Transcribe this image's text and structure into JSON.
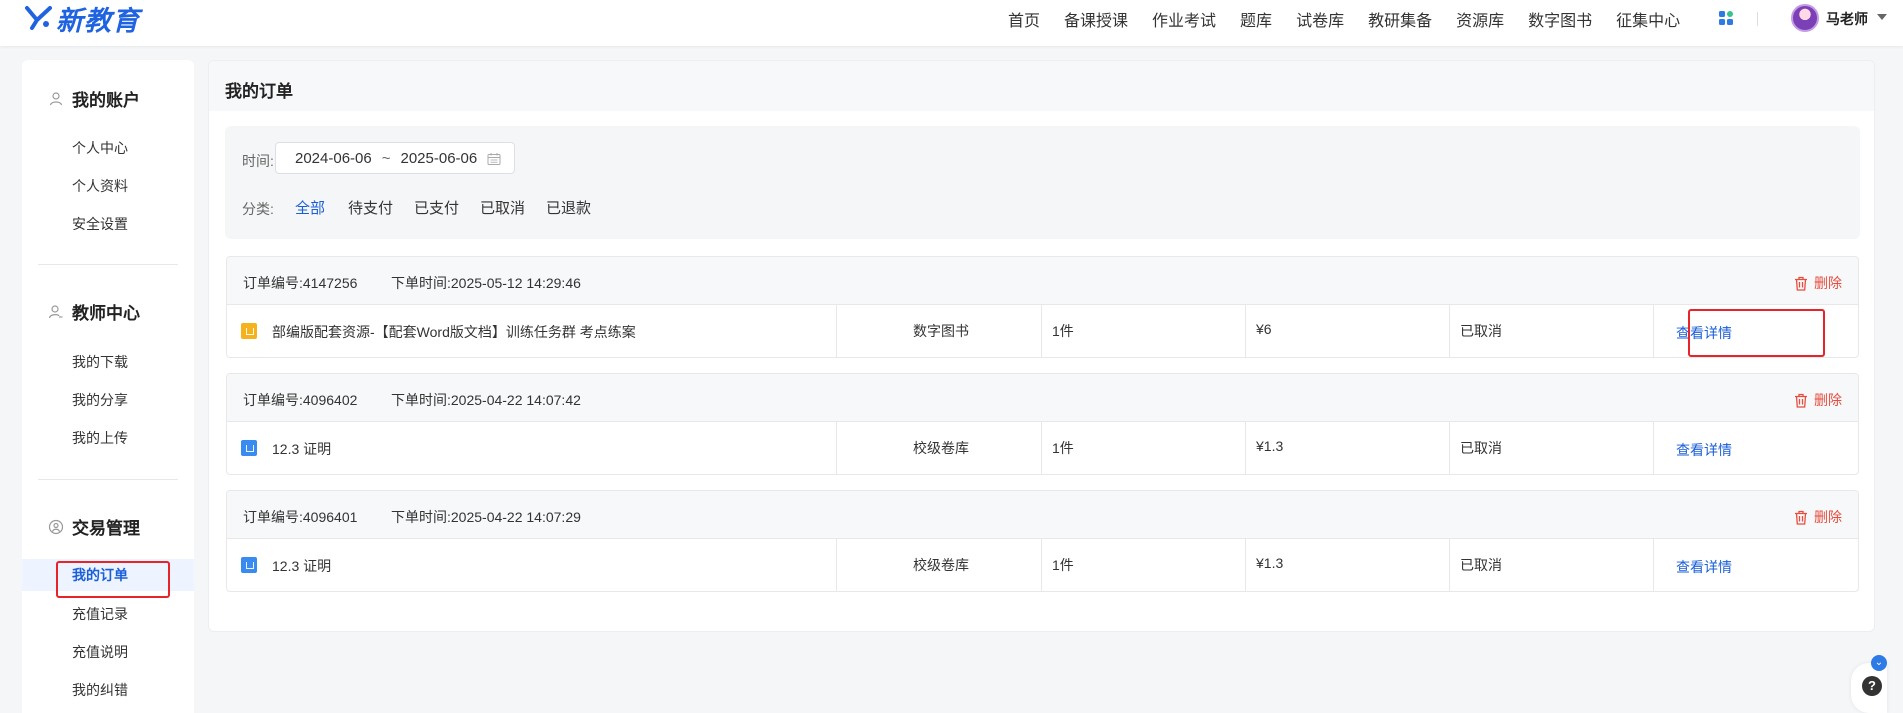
{
  "brand": {
    "name": "新教育",
    "color": "#1f63e0"
  },
  "nav": {
    "items": [
      "首页",
      "备课授课",
      "作业考试",
      "题库",
      "试卷库",
      "教研集备",
      "资源库",
      "数字图书",
      "征集中心"
    ],
    "apps_icon": "apps-grid-icon",
    "user_name": "马老师"
  },
  "sidebar": {
    "sections": [
      {
        "title": "我的账户",
        "icon": "user-icon",
        "items": [
          "个人中心",
          "个人资料",
          "安全设置"
        ]
      },
      {
        "title": "教师中心",
        "icon": "teacher-icon",
        "items": [
          "我的下载",
          "我的分享",
          "我的上传"
        ]
      },
      {
        "title": "交易管理",
        "icon": "trade-icon",
        "items": [
          "我的订单",
          "充值记录",
          "充值说明",
          "我的纠错"
        ]
      }
    ],
    "active_item": "我的订单"
  },
  "main": {
    "title": "我的订单",
    "filter": {
      "time_label": "时间:",
      "date_start": "2024-06-06",
      "date_sep": "~",
      "date_end": "2025-06-06",
      "category_label": "分类:",
      "categories": [
        "全部",
        "待支付",
        "已支付",
        "已取消",
        "已退款"
      ],
      "active_category": "全部"
    },
    "delete_label": "删除",
    "detail_label": "查看详情",
    "orders": [
      {
        "order_no": "订单编号:4147256",
        "order_time": "下单时间:2025-05-12 14:29:46",
        "icon": "doc-yellow-icon",
        "product": "部编版配套资源-【配套Word版文档】训练任务群    考点练案",
        "category": "数字图书",
        "quantity": "1件",
        "price": "¥6",
        "status": "已取消"
      },
      {
        "order_no": "订单编号:4096402",
        "order_time": "下单时间:2025-04-22 14:07:42",
        "icon": "word-blue-icon",
        "product": "12.3 证明",
        "category": "校级卷库",
        "quantity": "1件",
        "price": "¥1.3",
        "status": "已取消"
      },
      {
        "order_no": "订单编号:4096401",
        "order_time": "下单时间:2025-04-22 14:07:29",
        "icon": "word-blue-icon",
        "product": "12.3 证明",
        "category": "校级卷库",
        "quantity": "1件",
        "price": "¥1.3",
        "status": "已取消"
      }
    ]
  },
  "floating": {
    "help_label": "?",
    "icon": "help-icon"
  },
  "colors": {
    "accent": "#1a5ed9",
    "danger": "#e84c3d",
    "highlight": "#e8242a"
  }
}
